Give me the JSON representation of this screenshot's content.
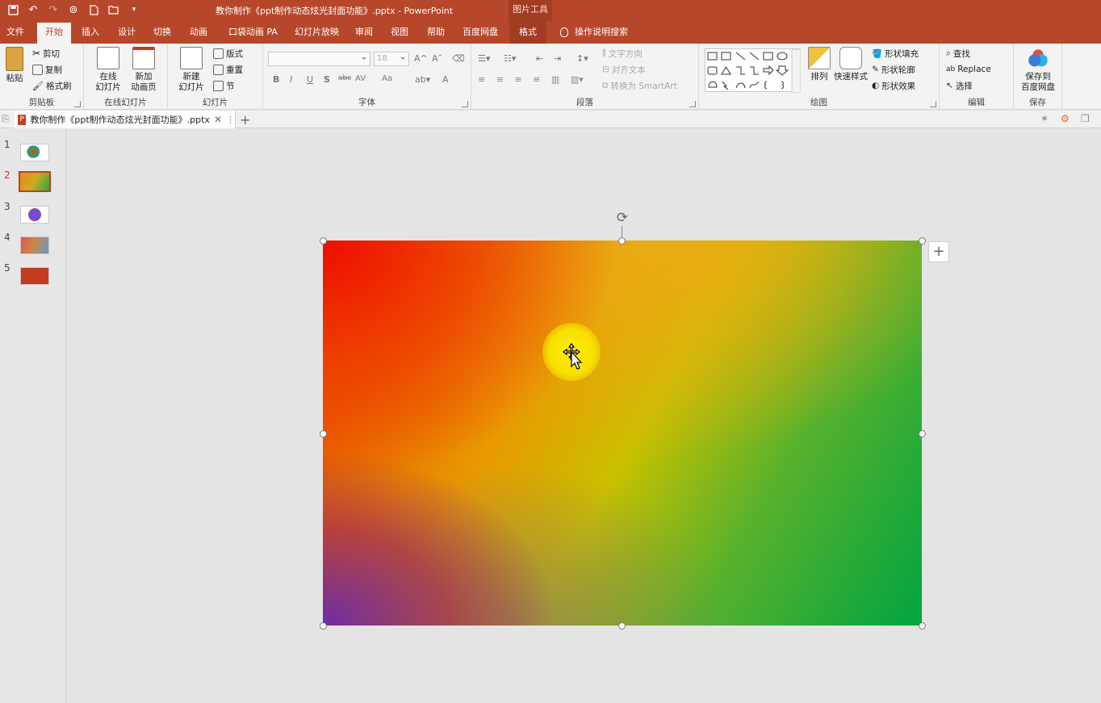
{
  "window": {
    "title": "教你制作《ppt制作动态炫光封面功能》.pptx  -  PowerPoint",
    "context_tool_title": "图片工具"
  },
  "qat": {
    "icons": [
      "save-icon",
      "undo-icon",
      "redo-icon",
      "read-mode-icon",
      "new-file-icon",
      "open-icon",
      "customize-icon"
    ]
  },
  "tabs": [
    {
      "label": "文件"
    },
    {
      "label": "开始"
    },
    {
      "label": "插入"
    },
    {
      "label": "设计"
    },
    {
      "label": "切换"
    },
    {
      "label": "动画"
    },
    {
      "label": "口袋动画 PA"
    },
    {
      "label": "幻灯片放映"
    },
    {
      "label": "审阅"
    },
    {
      "label": "视图"
    },
    {
      "label": "帮助"
    },
    {
      "label": "百度网盘"
    },
    {
      "label": "格式"
    }
  ],
  "tell_me": "操作说明搜索",
  "ribbon": {
    "clipboard": {
      "paste": "粘贴",
      "cut": "剪切",
      "copy": "复制",
      "format_painter": "格式刷",
      "label": "剪贴板"
    },
    "online": {
      "online_slides_1": "在线",
      "online_slides_2": "幻灯片",
      "new_anim_1": "新加",
      "new_anim_2": "动画页",
      "label": "在线幻灯片"
    },
    "slides": {
      "new_slide_1": "新建",
      "new_slide_2": "幻灯片",
      "layout": "版式",
      "reset": "重置",
      "section": "节",
      "label": "幻灯片"
    },
    "font": {
      "size": "18",
      "label": "字体",
      "bold": "B",
      "italic": "I",
      "underline": "U",
      "shadow": "S",
      "strike": "abc",
      "spacing": "AV",
      "case": "Aa",
      "color": "A"
    },
    "paragraph": {
      "text_direction": "文字方向",
      "align_text": "对齐文本",
      "smartart": "转换为 SmartArt",
      "label": "段落"
    },
    "drawing": {
      "arrange": "排列",
      "quick_styles": "快速样式",
      "fill": "形状填充",
      "outline": "形状轮廓",
      "effects": "形状效果",
      "label": "绘图"
    },
    "editing": {
      "find": "查找",
      "replace": "Replace",
      "select": "选择",
      "label": "编辑"
    },
    "save": {
      "save_1": "保存到",
      "save_2": "百度网盘",
      "label": "保存"
    }
  },
  "doc_tab": {
    "name": "教你制作《ppt制作动态炫光封面功能》.pptx"
  },
  "slides": [
    {
      "num": "1"
    },
    {
      "num": "2"
    },
    {
      "num": "3"
    },
    {
      "num": "4"
    },
    {
      "num": "5"
    }
  ],
  "colors": {
    "accent": "#b7472a",
    "ribbon_bg": "#f3f3f3",
    "canvas_bg": "#e4e4e4"
  }
}
